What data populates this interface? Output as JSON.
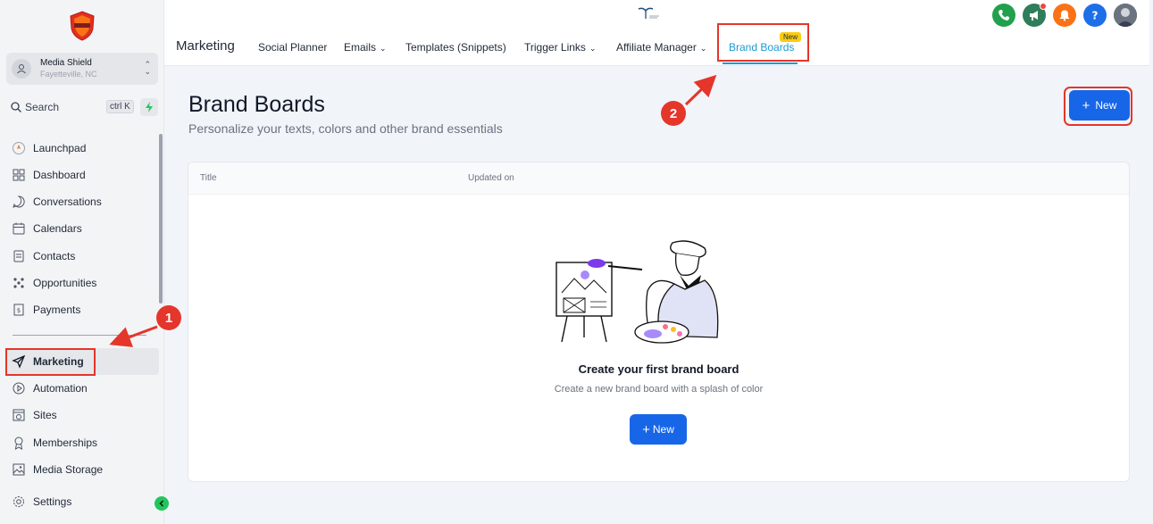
{
  "sidebar": {
    "account": {
      "name": "Media Shield",
      "location": "Fayetteville, NC"
    },
    "search": {
      "placeholder": "Search",
      "shortcut": "ctrl K"
    },
    "items": [
      {
        "label": "Launchpad",
        "icon": "rocket-icon"
      },
      {
        "label": "Dashboard",
        "icon": "dashboard-icon"
      },
      {
        "label": "Conversations",
        "icon": "chat-icon"
      },
      {
        "label": "Calendars",
        "icon": "calendar-icon"
      },
      {
        "label": "Contacts",
        "icon": "contacts-icon"
      },
      {
        "label": "Opportunities",
        "icon": "opportunities-icon"
      },
      {
        "label": "Payments",
        "icon": "payments-icon"
      },
      {
        "label": "Marketing",
        "icon": "send-icon",
        "active": true
      },
      {
        "label": "Automation",
        "icon": "automation-icon"
      },
      {
        "label": "Sites",
        "icon": "sites-icon"
      },
      {
        "label": "Memberships",
        "icon": "badge-icon"
      },
      {
        "label": "Media Storage",
        "icon": "image-icon"
      },
      {
        "label": "Settings",
        "icon": "gear-icon"
      }
    ]
  },
  "topbar": {
    "section": "Marketing",
    "tabs": [
      {
        "label": "Social Planner",
        "dropdown": false
      },
      {
        "label": "Emails",
        "dropdown": true
      },
      {
        "label": "Templates (Snippets)",
        "dropdown": false
      },
      {
        "label": "Trigger Links",
        "dropdown": true
      },
      {
        "label": "Affiliate Manager",
        "dropdown": true
      },
      {
        "label": "Brand Boards",
        "dropdown": false,
        "active": true,
        "badge": "New"
      }
    ],
    "icons": [
      "phone-icon",
      "megaphone-icon",
      "bell-icon",
      "help-icon",
      "user-avatar"
    ]
  },
  "main": {
    "title": "Brand Boards",
    "subtitle": "Personalize your texts, colors and other brand essentials",
    "new_button": "New",
    "table": {
      "columns": [
        "Title",
        "Updated on"
      ]
    },
    "empty_state": {
      "title": "Create your first brand board",
      "subtitle": "Create a new brand board with a splash of color",
      "button": "New"
    }
  },
  "annotations": {
    "step1": "1",
    "step2": "2"
  },
  "colors": {
    "primary": "#1766e8",
    "accent": "#1d9bd1",
    "annotation": "#e4362a",
    "badge": "#facc15"
  }
}
